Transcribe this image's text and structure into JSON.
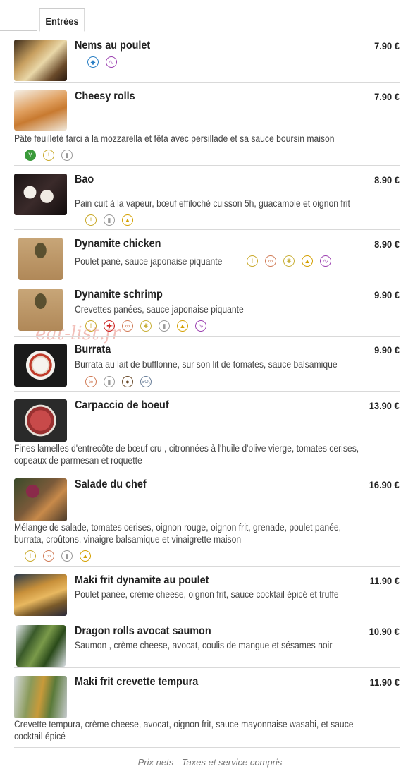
{
  "tab": {
    "label": "Entrées"
  },
  "watermark": "eat-list.fr",
  "footer": "Prix nets - Taxes et service compris",
  "items": [
    {
      "name": "Nems au poulet",
      "price": "7.90 €",
      "desc": ""
    },
    {
      "name": "Cheesy rolls",
      "price": "7.90 €",
      "desc": "Pâte feuilleté farci à la mozzarella et fêta avec persillade et sa sauce boursin maison"
    },
    {
      "name": "Bao",
      "price": "8.90 €",
      "desc": "Pain cuit à la vapeur, bœuf effiloché cuisson 5h, guacamole et oignon frit"
    },
    {
      "name": "Dynamite chicken",
      "price": "8.90 €",
      "desc": "Poulet pané, sauce japonaise piquante"
    },
    {
      "name": "Dynamite schrimp",
      "price": "9.90 €",
      "desc": "Crevettes panées, sauce japonaise piquante"
    },
    {
      "name": "Burrata",
      "price": "9.90 €",
      "desc": "Burrata au lait de bufflonne, sur son lit de tomates, sauce balsamique"
    },
    {
      "name": "Carpaccio de boeuf",
      "price": "13.90 €",
      "desc1": "Fines lamelles d'entrecôte de bœuf cru , citronnées à l'huile d'olive vierge, tomates cerises,",
      "desc2": "copeaux de parmesan et roquette"
    },
    {
      "name": "Salade du chef",
      "price": "16.90 €",
      "desc1": "Mélange de salade, tomates cerises, oignon rouge, oignon frit, grenade, poulet panée,",
      "desc2": "burrata, croûtons, vinaigre balsamique et vinaigrette maison"
    },
    {
      "name": "Maki frit dynamite au poulet",
      "price": "11.90 €",
      "desc": "Poulet panée, crème cheese, oignon frit, sauce cocktail épicé et truffe"
    },
    {
      "name": "Dragon rolls avocat saumon",
      "price": "10.90 €",
      "desc": "Saumon , crème cheese, avocat, coulis de mangue et sésames noir"
    },
    {
      "name": "Maki frit crevette tempura",
      "price": "11.90 €",
      "desc1": "Crevette tempura, crème cheese, avocat, oignon frit, sauce mayonnaise wasabi, et sauce",
      "desc2": "cocktail épicé"
    }
  ],
  "allergen_icons": {
    "fish": {
      "color": "#2a7fc4",
      "symbol": "◆"
    },
    "gluten": {
      "color": "#c9a92a",
      "symbol": "!"
    },
    "milk": {
      "color": "#999999",
      "symbol": "▮"
    },
    "egg": {
      "color": "#d4a000",
      "symbol": "▲"
    },
    "soy": {
      "color": "#9b3fb0",
      "symbol": "∿"
    },
    "vegetarian": {
      "color": "#3a9a3a",
      "symbol": "Y"
    },
    "nuts": {
      "color": "#d07a55",
      "symbol": "∞"
    },
    "sesame": {
      "color": "#c9b03a",
      "symbol": "✱"
    },
    "crustacean": {
      "color": "#cc2222",
      "symbol": "✚"
    },
    "mustard": {
      "color": "#6a4a2a",
      "symbol": "●"
    },
    "sulphites": {
      "color": "#6a7f9a",
      "symbol": "SO₂"
    }
  }
}
